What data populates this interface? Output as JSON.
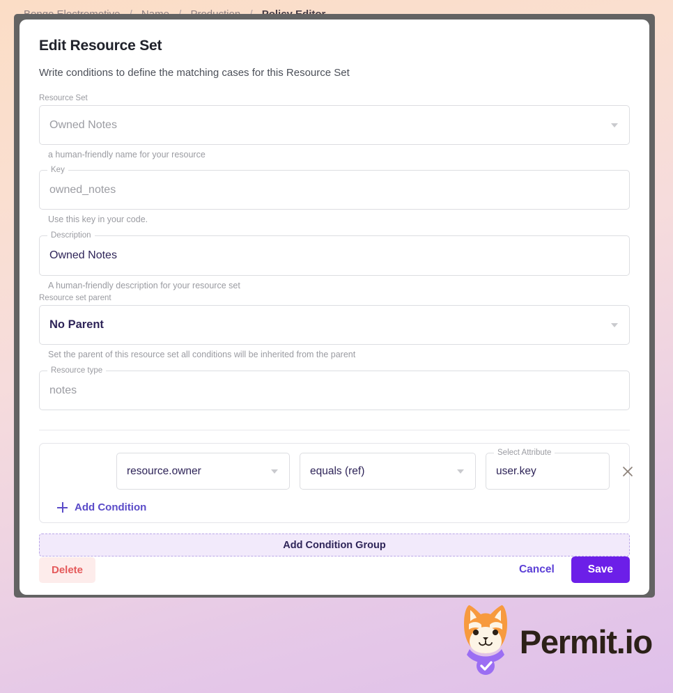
{
  "breadcrumb": {
    "items": [
      "Bongo Electromotive",
      "Name",
      "Production"
    ],
    "current": "Policy Editor",
    "separator": "/"
  },
  "modal": {
    "title": "Edit Resource Set",
    "subtitle": "Write conditions to define the matching cases for this Resource Set",
    "fields": {
      "resource_set": {
        "label": "Resource Set",
        "value": "Owned Notes",
        "helper": "a human-friendly name for your resource",
        "icon": "chevron-down-icon"
      },
      "key": {
        "label": "Key",
        "value": "owned_notes",
        "helper": "Use this key in your code."
      },
      "description": {
        "label": "Description",
        "value": "Owned Notes",
        "helper": "A human-friendly description for your resource set"
      },
      "parent": {
        "label": "Resource set parent",
        "value": "No Parent",
        "helper": "Set the parent of this resource set all conditions will be inherited from the parent",
        "icon": "chevron-down-icon"
      },
      "resource_type": {
        "label": "Resource type",
        "value": "notes"
      }
    },
    "condition_group": {
      "rows": [
        {
          "subject": "resource.owner",
          "operator": "equals (ref)",
          "attribute_label": "Select Attribute",
          "attribute_value": "user.key",
          "remove_icon": "close-icon"
        }
      ],
      "add_condition_label": "Add Condition",
      "add_condition_icon": "plus-icon",
      "add_group_label": "Add Condition Group"
    },
    "actions": {
      "delete": "Delete",
      "cancel": "Cancel",
      "save": "Save"
    }
  },
  "logo": {
    "wordmark": "Permit.io",
    "mark": "shiba-dog-icon"
  },
  "colors": {
    "accent_purple": "#6c1fe8",
    "link_purple": "#5a4bc8",
    "delete_red": "#e4595a",
    "delete_bg": "#fdeceb",
    "group_bg": "#f2eafb",
    "value_text": "#2e2458",
    "scrim": "#636363"
  }
}
